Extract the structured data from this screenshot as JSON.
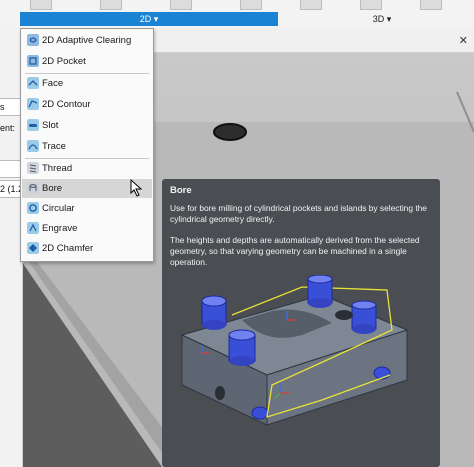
{
  "ribbon": {
    "tab_2d_label": "2D",
    "tab_3d_label": "3D"
  },
  "left_panel": {
    "item1": "s",
    "item2": "ent:",
    "item3": "2 (1.2"
  },
  "menu": {
    "items": [
      {
        "label": "2D Adaptive Clearing",
        "icon": "adaptive-clearing-icon"
      },
      {
        "label": "2D Pocket",
        "icon": "pocket-icon"
      },
      {
        "label": "Face",
        "icon": "face-icon"
      },
      {
        "label": "2D Contour",
        "icon": "contour-icon"
      },
      {
        "label": "Slot",
        "icon": "slot-icon"
      },
      {
        "label": "Trace",
        "icon": "trace-icon"
      },
      {
        "label": "Thread",
        "icon": "thread-icon"
      },
      {
        "label": "Bore",
        "icon": "bore-icon"
      },
      {
        "label": "Circular",
        "icon": "circular-icon"
      },
      {
        "label": "Engrave",
        "icon": "engrave-icon"
      },
      {
        "label": "2D Chamfer",
        "icon": "chamfer-icon"
      }
    ],
    "highlighted": "Bore"
  },
  "tooltip": {
    "title": "Bore",
    "paragraph1": "Use for bore milling of cylindrical pockets and islands by selecting the cylindrical geometry directly.",
    "paragraph2": "The heights and depths are automatically derived from the selected geometry, so that varying geometry can be machined in a single operation."
  },
  "colors": {
    "ribbon_accent": "#1a83d4",
    "tooltip_bg": "#4a4d52",
    "part_body": "#6b7480",
    "bore_highlight": "#3a4fd8",
    "path_line": "#e8e23a"
  }
}
